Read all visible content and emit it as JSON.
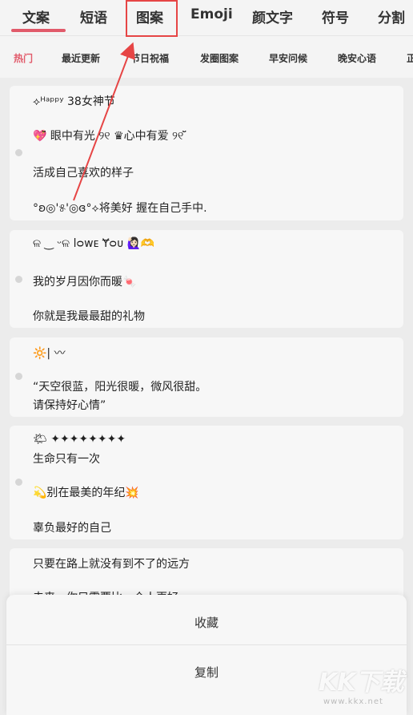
{
  "tabs": [
    {
      "label": "文案",
      "active": true
    },
    {
      "label": "短语",
      "active": false
    },
    {
      "label": "图案",
      "active": false
    },
    {
      "label": "Emoji",
      "active": false
    },
    {
      "label": "颜文字",
      "active": false
    },
    {
      "label": "符号",
      "active": false
    },
    {
      "label": "分割",
      "active": false
    }
  ],
  "categories": [
    {
      "label": "热门",
      "active": true
    },
    {
      "label": "最近更新",
      "active": false
    },
    {
      "label": "节日祝福",
      "active": false
    },
    {
      "label": "发圈图案",
      "active": false
    },
    {
      "label": "早安问候",
      "active": false
    },
    {
      "label": "晚安心语",
      "active": false
    },
    {
      "label": "正",
      "active": false
    }
  ],
  "cards": [
    {
      "lines": [
        "⟡ᴴᵃᵖᵖʸ 38女神节",
        "💖̆̈ 眼中有光 ୨୧ ♛心中有爱 ୨୧ ̆̈",
        "活成自己喜欢的样子",
        "°ʚ◎'୫'◎ɞ°⟡将美好 握在自己手中."
      ]
    },
    {
      "lines": [
        "ଳ ‿ ᵕଳ lᴑᴡᴇ Ɏᴑᴜ 🙋🏻‍♀️🫶",
        "我的岁月因你而暖🍬",
        "你就是我最最甜的礼物"
      ]
    },
    {
      "lines": [
        "🔆|                              〰",
        "“天空很蓝，阳光很暖，微风很甜。",
        "请保持好心情”"
      ]
    },
    {
      "lines": [
        "🌤                    ✦✦✦✦✦✦✦✦",
        "生命只有一次",
        "💫别在最美的年纪💥",
        "辜负最好的自己"
      ]
    },
    {
      "lines": [
        "只要在路上就没有到不了的远方",
        "未来，你只需要比一个人更好"
      ]
    }
  ],
  "sheet": {
    "favorite": "收藏",
    "copy": "复制"
  },
  "watermark": {
    "brand": "KK下载",
    "url": "www.kkx.net"
  },
  "annotation_color": "#e64545",
  "accent_color": "#e15a6a"
}
